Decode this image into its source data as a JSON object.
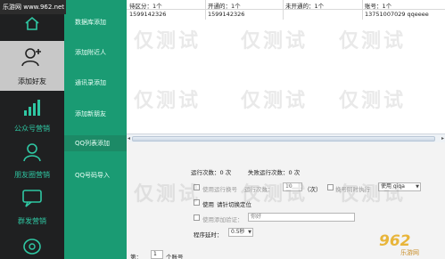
{
  "site_tag": "乐游网 www.962.net",
  "nav": {
    "items": [
      {
        "label": "",
        "icon": "home-icon"
      },
      {
        "label": "添加好友",
        "icon": "add-user-icon"
      },
      {
        "label": "公众号营销",
        "icon": "bar-chart-icon"
      },
      {
        "label": "朋友圈营销",
        "icon": "users-icon"
      },
      {
        "label": "群发营销",
        "icon": "chat-icon"
      },
      {
        "label": "",
        "icon": "bubble-icon"
      }
    ],
    "active": "添加好友"
  },
  "submenu": {
    "items": [
      "数据库添加",
      "添加附近人",
      "通讯录添加",
      "添加新朋友",
      "QQ列表添加",
      "QQ号码导入"
    ]
  },
  "table": {
    "headers": [
      "待区分：1个",
      "开通的：1个",
      "未开通的：1个",
      "账号：1个"
    ],
    "row": [
      "1599142326",
      "1599142326",
      "",
      "13751007029 qqeeee"
    ]
  },
  "panel": {
    "run_count_label": "运行次数：0 次",
    "fail_count_label": "失败运行次数：0 次",
    "use_run_switch_label": "使用运行换号",
    "run_count_field_label": "运行次数：",
    "run_count_value": "10",
    "times_unit": "（次）",
    "after_n_label": "换号同时执行",
    "use_select_value": "使用 qiqa",
    "use_label": "使用",
    "switch_location_label": "请针切换定位",
    "use_validation_label": "使用添加验证：",
    "validation_placeholder": "你好",
    "delay_label": "程序延时：",
    "delay_value": "0.5秒",
    "page_prefix": "第：",
    "page_value": "1",
    "page_suffix": "个账号"
  },
  "watermark": "仅测试",
  "brand": {
    "number": "962",
    "text": "乐游网"
  },
  "colors": {
    "nav_bg": "#1f2021",
    "accent_teal": "#2fc7a3",
    "submenu_green": "#1a9b73"
  }
}
